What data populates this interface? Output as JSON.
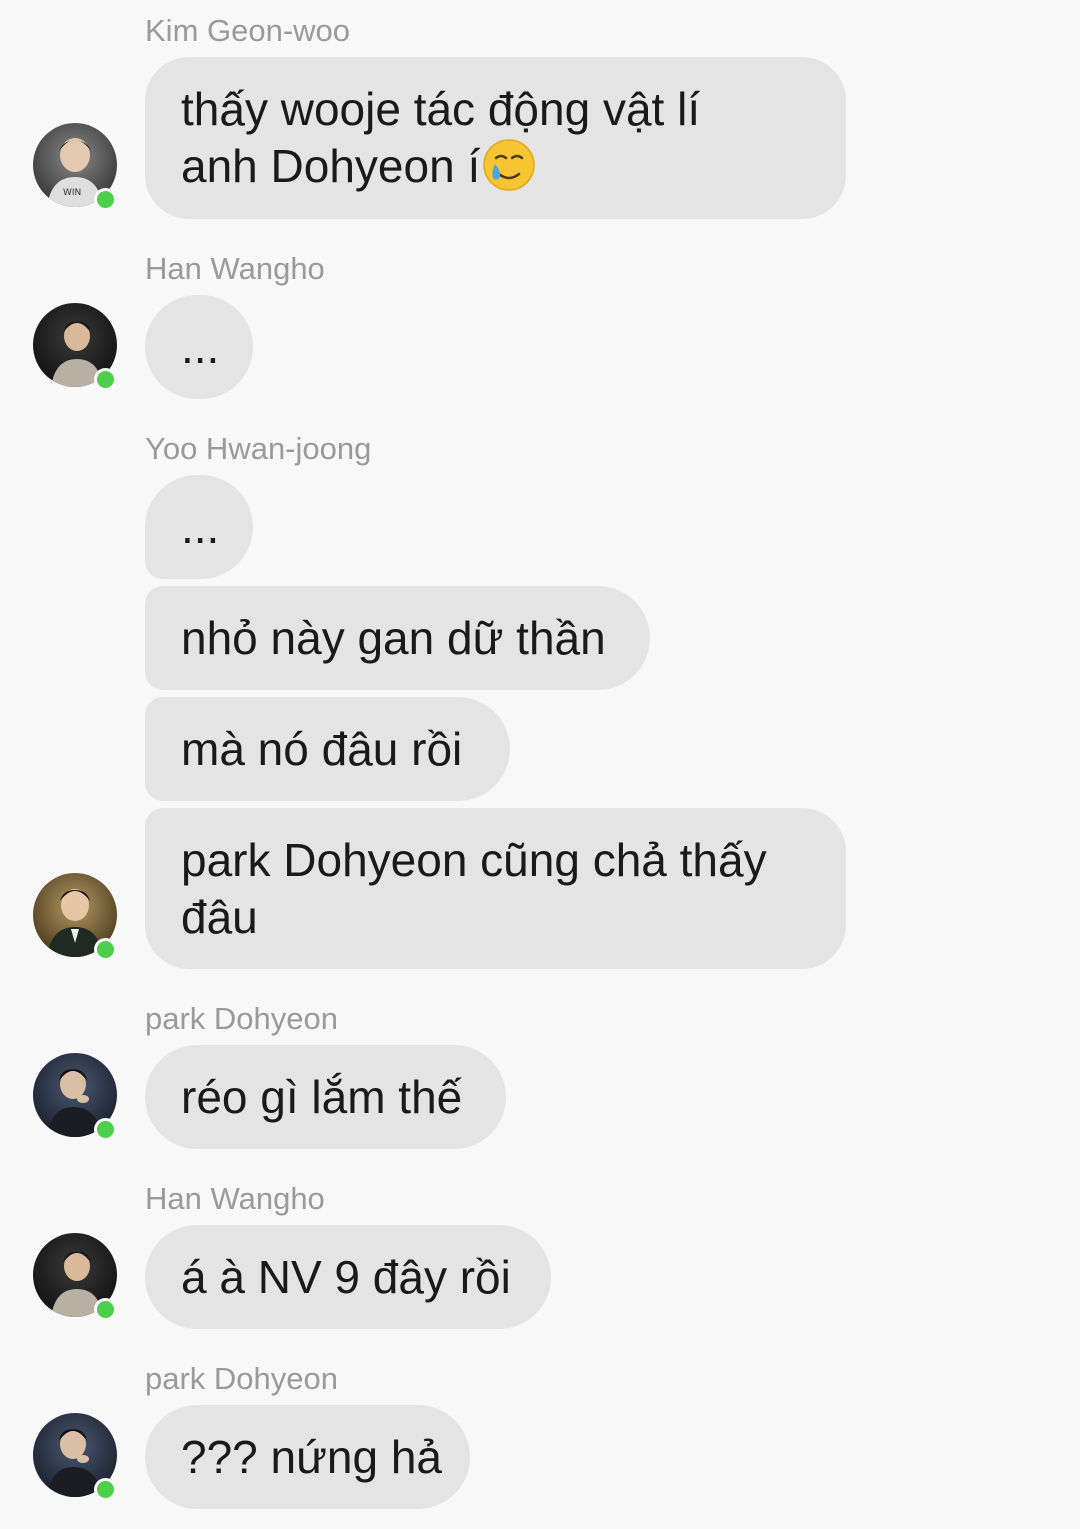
{
  "colors": {
    "background": "#f8f8f8",
    "bubble": "#e4e4e4",
    "sender_name": "#9a9a9a",
    "online_indicator": "#4cd04c"
  },
  "messages": [
    {
      "sender": "Kim Geon-woo",
      "avatar_icon": "avatar-kim-geon-woo",
      "online": true,
      "bubbles": [
        {
          "lines": [
            "thấy wooje tác động vật lí",
            "anh Dohyeon í"
          ],
          "trailing_icon": "crying-smile-emoji-icon"
        }
      ]
    },
    {
      "sender": "Han Wangho",
      "avatar_icon": "avatar-han-wangho",
      "online": true,
      "bubbles": [
        {
          "lines": [
            "..."
          ]
        }
      ]
    },
    {
      "sender": "Yoo Hwan-joong",
      "avatar_icon": "avatar-yoo-hwan-joong",
      "online": true,
      "bubbles": [
        {
          "lines": [
            "..."
          ]
        },
        {
          "lines": [
            "nhỏ này gan dữ thần"
          ]
        },
        {
          "lines": [
            "mà nó đâu rồi"
          ]
        },
        {
          "lines": [
            "park Dohyeon cũng chả thấy",
            "đâu"
          ]
        }
      ]
    },
    {
      "sender": "park Dohyeon",
      "avatar_icon": "avatar-park-dohyeon",
      "online": true,
      "bubbles": [
        {
          "lines": [
            "réo gì lắm thế"
          ]
        }
      ]
    },
    {
      "sender": "Han Wangho",
      "avatar_icon": "avatar-han-wangho",
      "online": true,
      "bubbles": [
        {
          "lines": [
            "á à NV 9 đây rồi"
          ]
        }
      ]
    },
    {
      "sender": "park Dohyeon",
      "avatar_icon": "avatar-park-dohyeon",
      "online": true,
      "bubbles": [
        {
          "lines": [
            "??? nứng hả"
          ]
        }
      ]
    }
  ]
}
